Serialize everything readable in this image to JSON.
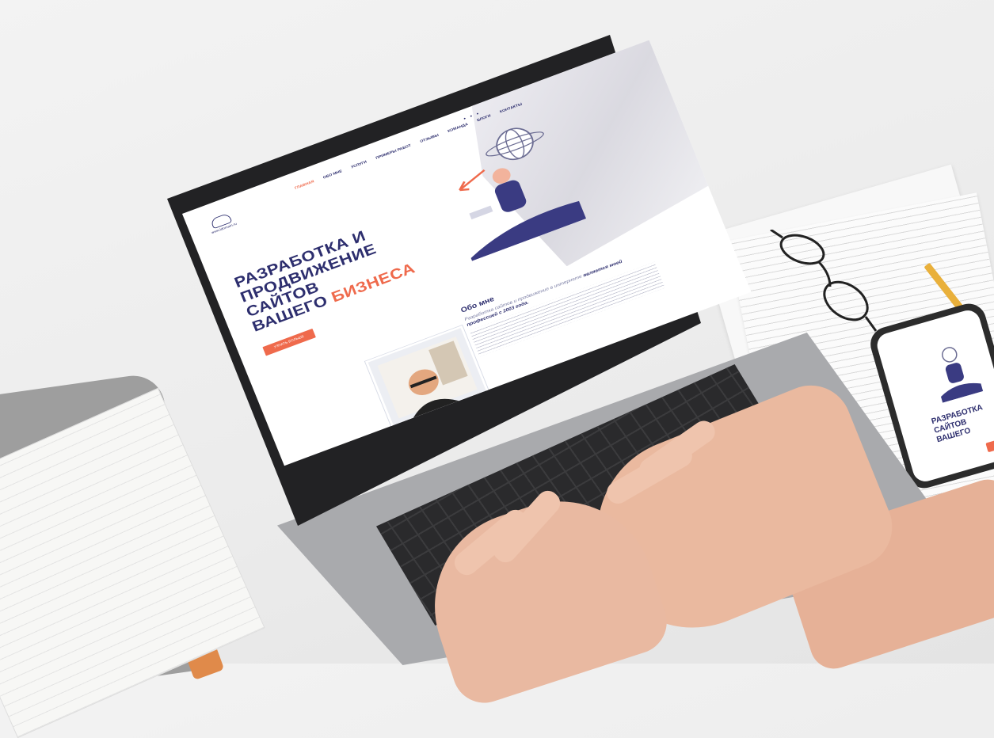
{
  "site": {
    "logo_text": "www.ldomain.ru",
    "nav": [
      {
        "label": "ГЛАВНАЯ",
        "active": true
      },
      {
        "label": "ОБО МНЕ",
        "active": false
      },
      {
        "label": "УСЛУГИ",
        "active": false
      },
      {
        "label": "ПРИМЕРЫ РАБОТ",
        "active": false
      },
      {
        "label": "ОТЗЫВЫ",
        "active": false
      },
      {
        "label": "КОМАНДА",
        "active": false
      },
      {
        "label": "БЛОГИ",
        "active": false
      },
      {
        "label": "КОНТАКТЫ",
        "active": false
      }
    ],
    "hero": {
      "title_line1": "РАЗРАБОТКА И",
      "title_line2": "ПРОДВИЖЕНИЕ",
      "title_line3": "САЙТОВ",
      "title_line4_prefix": "ВАШЕГО ",
      "title_line4_accent": "БИЗНЕСА",
      "button": "УЗНАТЬ БОЛЬШЕ"
    },
    "about": {
      "title": "Обо мне",
      "lead_prefix": "Разработка сайтов и продвижение в интернете",
      "lead_rest": "является моей профессией с 2003 года."
    }
  },
  "phone": {
    "title_line1": "РАЗРАБОТКА",
    "title_line2": "САЙТОВ",
    "title_line3": "ВАШЕГО"
  },
  "colors": {
    "brand_navy": "#2d2e6e",
    "accent": "#ef6a4c"
  },
  "icons": [
    "cloud-logo-icon",
    "twitter-icon",
    "facebook-icon",
    "instagram-icon",
    "globe-icon"
  ]
}
